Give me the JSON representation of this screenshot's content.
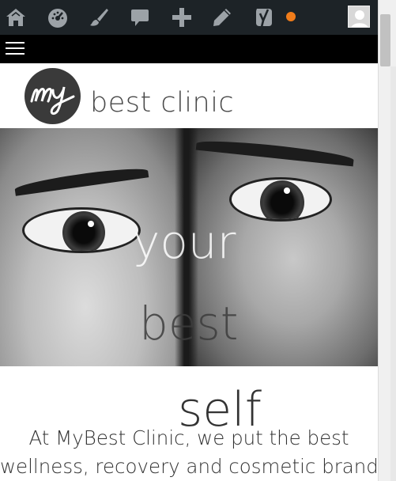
{
  "admin_bar": {
    "icons": [
      "site-home-icon",
      "dashboard-icon",
      "customize-brush-icon",
      "comments-icon",
      "new-content-icon",
      "edit-pencil-icon",
      "yoast-seo-icon"
    ],
    "notification_color": "#f07c1a"
  },
  "site": {
    "logo_mark": "My",
    "name": "best clinic"
  },
  "hero": {
    "word_1": "your",
    "word_2": "best",
    "word_3": "self"
  },
  "intro": {
    "line_1": "At MyBest Clinic, we put the best",
    "line_2": "wellness, recovery and cosmetic brands"
  },
  "colors": {
    "admin_bar_bg": "#1d2327",
    "menu_bar_bg": "#000000",
    "text": "#333333"
  }
}
